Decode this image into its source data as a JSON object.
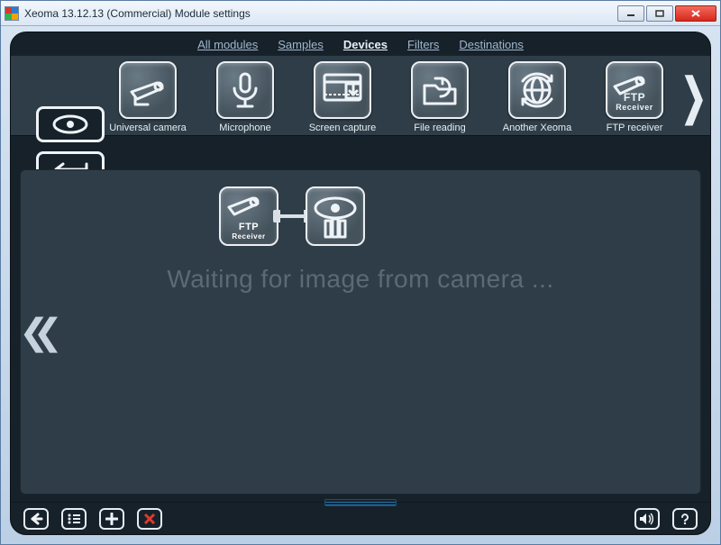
{
  "window": {
    "title": "Xeoma 13.12.13 (Commercial) Module settings"
  },
  "tabs": {
    "items": [
      {
        "label": "All modules",
        "active": false
      },
      {
        "label": "Samples",
        "active": false
      },
      {
        "label": "Devices",
        "active": true
      },
      {
        "label": "Filters",
        "active": false
      },
      {
        "label": "Destinations",
        "active": false
      }
    ]
  },
  "modules": {
    "items": [
      {
        "label": "Universal camera"
      },
      {
        "label": "Microphone"
      },
      {
        "label": "Screen capture"
      },
      {
        "label": "File reading"
      },
      {
        "label": "Another Xeoma"
      },
      {
        "label": "FTP receiver"
      }
    ]
  },
  "pipeline": {
    "nodes": [
      {
        "label1": "FTP",
        "label2": "Receiver"
      },
      {
        "label1": "",
        "label2": ""
      }
    ]
  },
  "canvas": {
    "waiting_text": "Waiting for image from camera ..."
  }
}
